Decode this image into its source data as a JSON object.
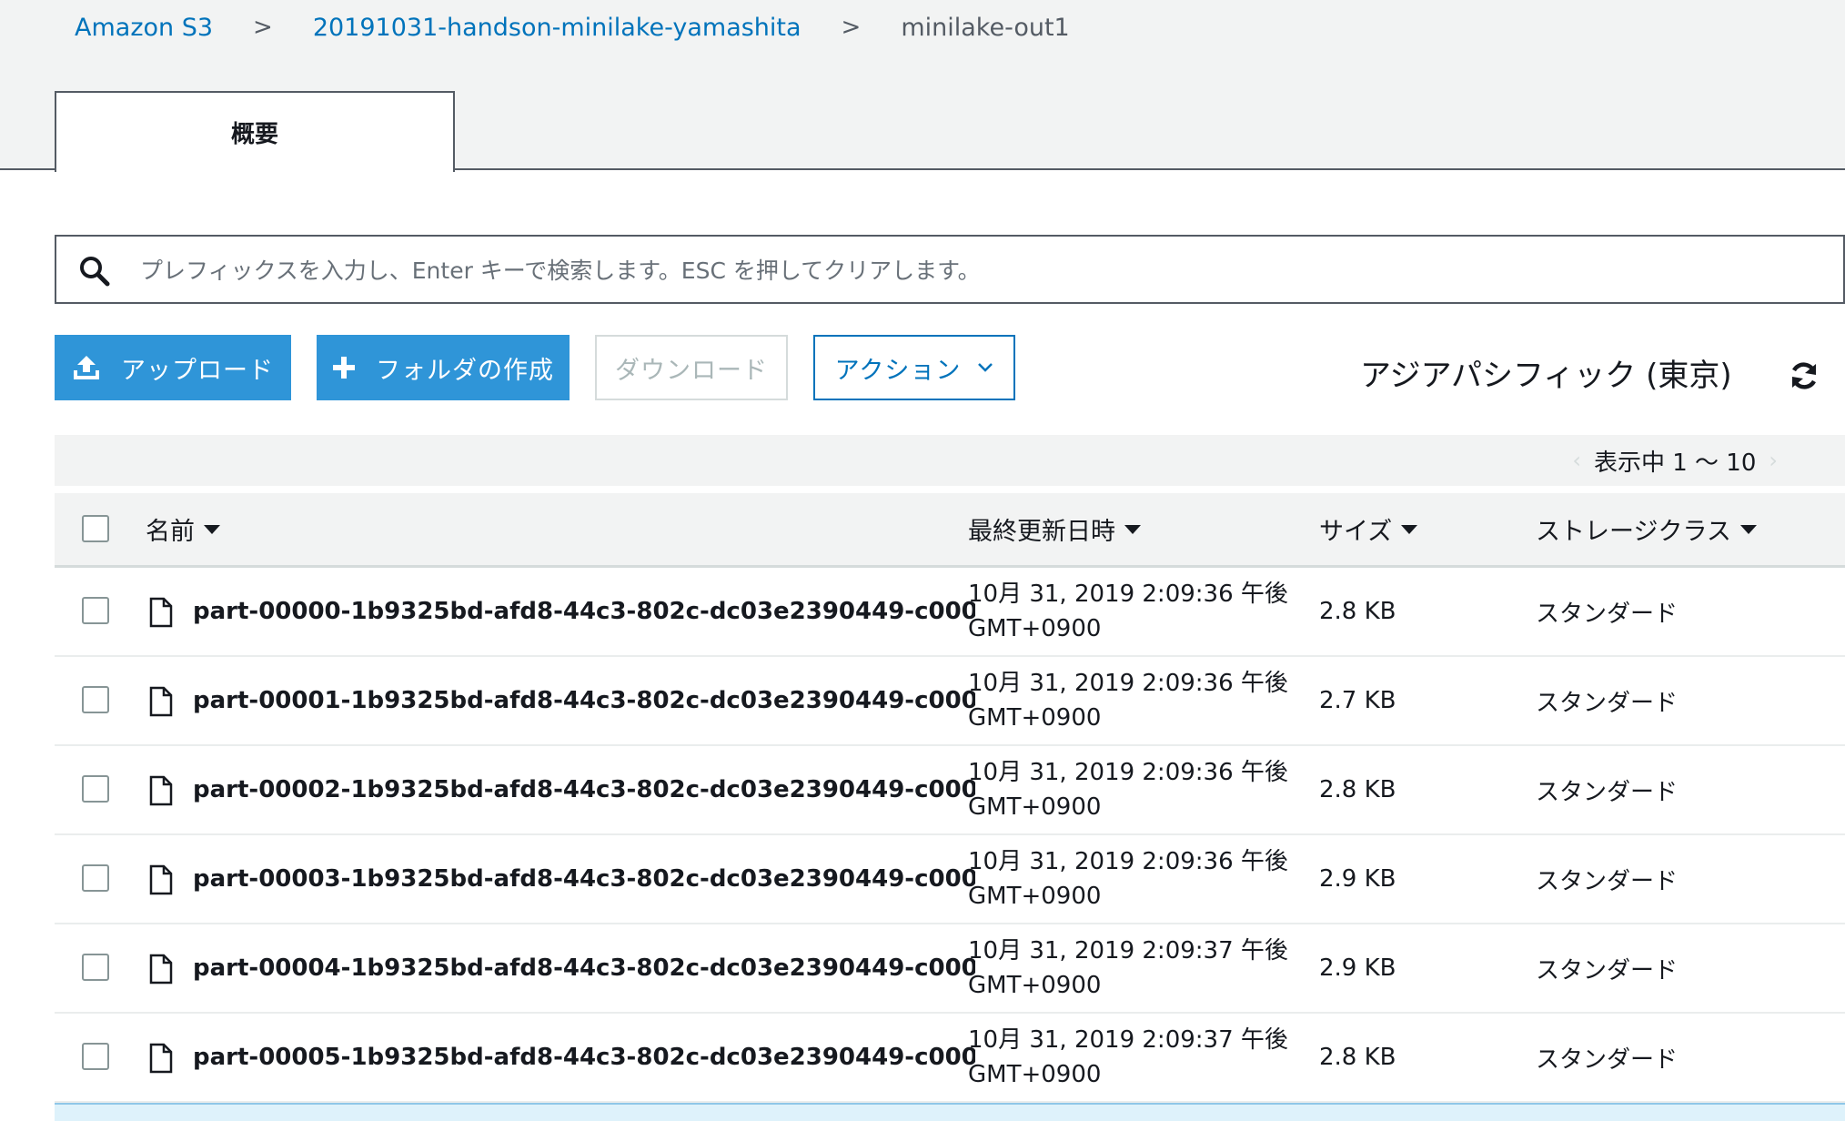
{
  "breadcrumb": {
    "root": "Amazon S3",
    "bucket": "20191031-handson-minilake-yamashita",
    "folder": "minilake-out1",
    "separator": ">"
  },
  "tabs": [
    {
      "label": "概要"
    }
  ],
  "search": {
    "placeholder": "プレフィックスを入力し、Enter キーで検索します。ESC を押してクリアします。",
    "value": ""
  },
  "toolbar": {
    "upload_label": "アップロード",
    "create_folder_label": "フォルダの作成",
    "download_label": "ダウンロード",
    "actions_label": "アクション"
  },
  "region": "アジアパシフィック (東京)",
  "pagination": {
    "label": "表示中 1 ～ 10"
  },
  "columns": {
    "name": "名前",
    "last_modified": "最終更新日時",
    "size": "サイズ",
    "storage_class": "ストレージクラス"
  },
  "rows": [
    {
      "name": "part-00000-1b9325bd-afd8-44c3-802c-dc03e2390449-c000....",
      "date_line1": "10月 31, 2019 2:09:36 午後",
      "date_line2": "GMT+0900",
      "size": "2.8 KB",
      "storage_class": "スタンダード"
    },
    {
      "name": "part-00001-1b9325bd-afd8-44c3-802c-dc03e2390449-c000....",
      "date_line1": "10月 31, 2019 2:09:36 午後",
      "date_line2": "GMT+0900",
      "size": "2.7 KB",
      "storage_class": "スタンダード"
    },
    {
      "name": "part-00002-1b9325bd-afd8-44c3-802c-dc03e2390449-c000....",
      "date_line1": "10月 31, 2019 2:09:36 午後",
      "date_line2": "GMT+0900",
      "size": "2.8 KB",
      "storage_class": "スタンダード"
    },
    {
      "name": "part-00003-1b9325bd-afd8-44c3-802c-dc03e2390449-c000....",
      "date_line1": "10月 31, 2019 2:09:36 午後",
      "date_line2": "GMT+0900",
      "size": "2.9 KB",
      "storage_class": "スタンダード"
    },
    {
      "name": "part-00004-1b9325bd-afd8-44c3-802c-dc03e2390449-c000....",
      "date_line1": "10月 31, 2019 2:09:37 午後",
      "date_line2": "GMT+0900",
      "size": "2.9 KB",
      "storage_class": "スタンダード"
    },
    {
      "name": "part-00005-1b9325bd-afd8-44c3-802c-dc03e2390449-c000....",
      "date_line1": "10月 31, 2019 2:09:37 午後",
      "date_line2": "GMT+0900",
      "size": "2.8 KB",
      "storage_class": "スタンダード"
    }
  ],
  "icons": {
    "search": "search-icon",
    "upload": "upload-icon",
    "plus": "plus-icon",
    "chevron": "chevron-down-icon",
    "refresh": "refresh-icon",
    "file": "file-icon"
  },
  "colors": {
    "accent": "#2f95d8",
    "link": "#0073bb"
  }
}
